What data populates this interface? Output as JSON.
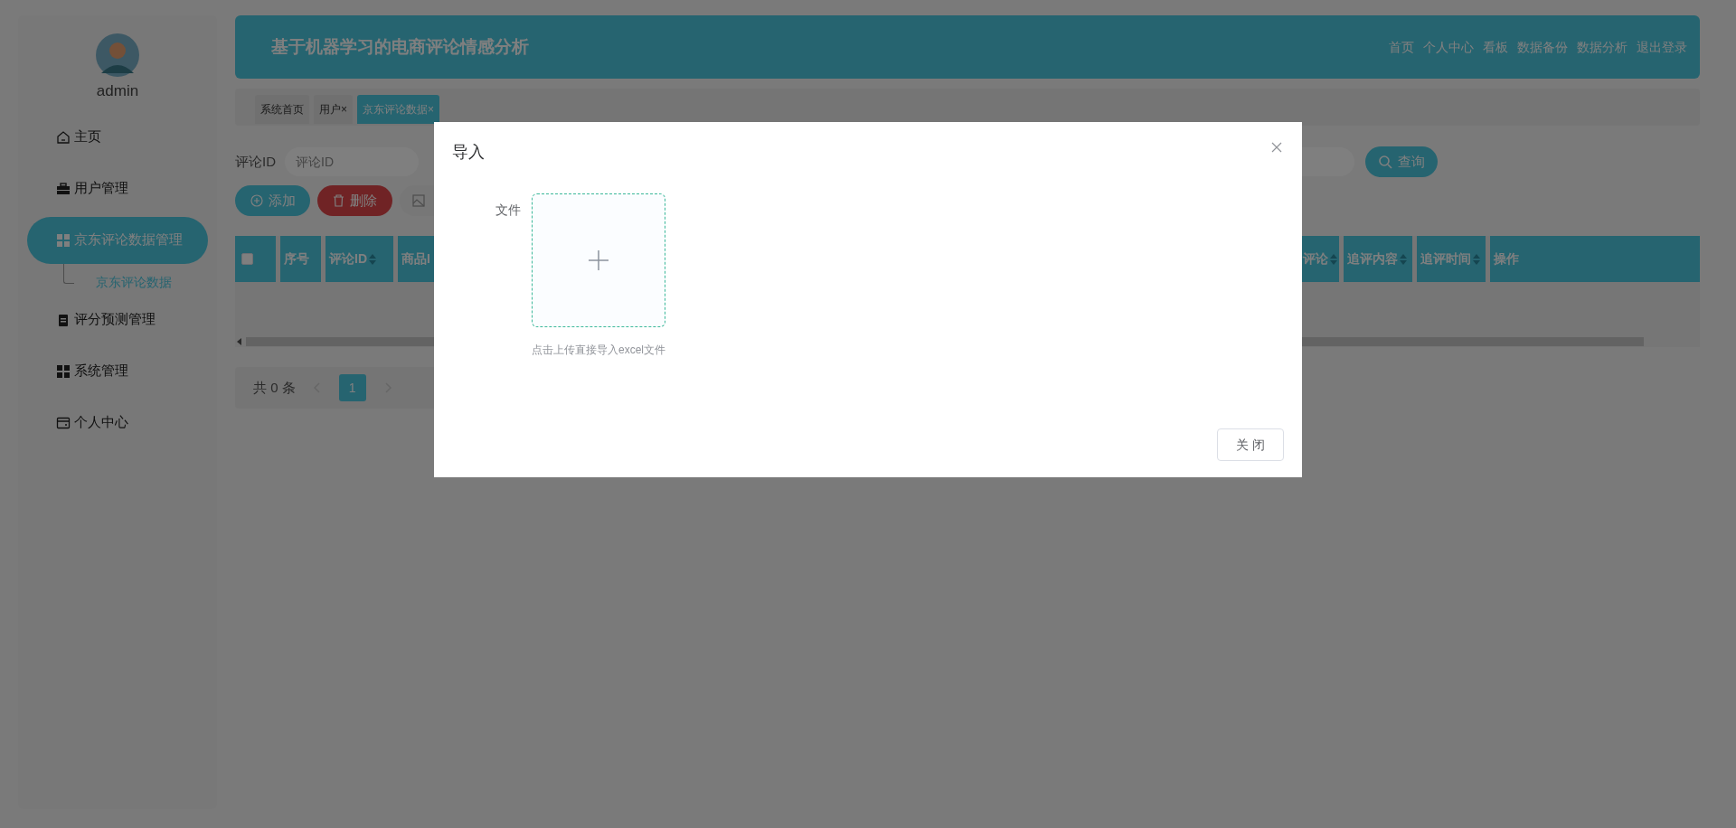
{
  "sidebar": {
    "user": {
      "name": "admin"
    },
    "items": [
      {
        "label": "主页",
        "selected": false
      },
      {
        "label": "用户管理",
        "selected": false
      },
      {
        "label": "京东评论数据管理",
        "selected": true,
        "children": [
          {
            "label": "京东评论数据",
            "selected": true
          }
        ]
      },
      {
        "label": "评分预测管理",
        "selected": false
      },
      {
        "label": "系统管理",
        "selected": false
      },
      {
        "label": "个人中心",
        "selected": false
      }
    ]
  },
  "header": {
    "title": "基于机器学习的电商评论情感分析",
    "nav": [
      "首页",
      "个人中心",
      "看板",
      "数据备份",
      "数据分析",
      "退出登录"
    ]
  },
  "tabs": [
    {
      "label": "系统首页",
      "selected": false
    },
    {
      "label": "用户",
      "close": "×",
      "selected": false
    },
    {
      "label": "京东评论数据",
      "close": "×",
      "selected": true
    }
  ],
  "search": {
    "label": "评论ID",
    "placeholder": "评论ID",
    "button": "查询"
  },
  "actions": [
    {
      "kind": "add",
      "label": "添加"
    },
    {
      "kind": "delete",
      "label": "删除"
    },
    {
      "kind": "more"
    }
  ],
  "table": {
    "columns_left": [
      {
        "kind": "checkbox",
        "checked": false
      },
      {
        "kind": "text",
        "label": "序号",
        "sortable": false
      },
      {
        "kind": "text",
        "label": "评论ID",
        "sortable": true
      },
      {
        "kind": "text",
        "label": "商品I"
      }
    ],
    "columns_right": [
      {
        "kind": "text",
        "label": "评论",
        "sortable": true
      },
      {
        "kind": "text",
        "label": "追评内容",
        "sortable": true
      },
      {
        "kind": "text",
        "label": "追评时间",
        "sortable": true
      },
      {
        "kind": "text",
        "label": "操作",
        "sortable": false
      }
    ]
  },
  "pagination": {
    "total": "共 0 条",
    "pages": [
      {
        "label": "1",
        "selected": true
      }
    ]
  },
  "dialog": {
    "title": "导入",
    "field_label": "文件",
    "upload_hint": "点击上传直接导入excel文件",
    "button": "关 闭"
  }
}
